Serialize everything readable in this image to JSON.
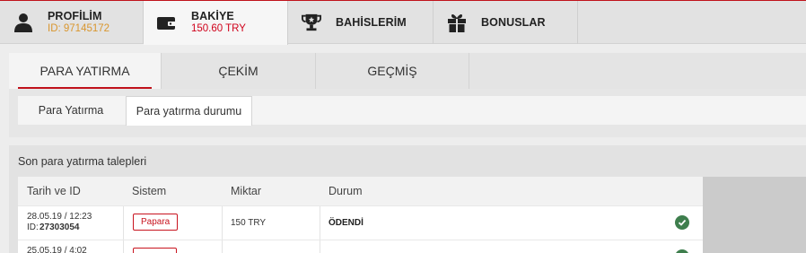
{
  "topnav": {
    "tabs": [
      {
        "title": "PROFİLİM",
        "sub": "ID: 97145172",
        "icon": "user-icon"
      },
      {
        "title": "BAKİYE",
        "sub": "150.60 TRY",
        "icon": "wallet-icon"
      },
      {
        "title": "BAHİSLERİM",
        "icon": "trophy-icon"
      },
      {
        "title": "BONUSLAR",
        "icon": "gift-icon"
      }
    ]
  },
  "subnav": {
    "tabs": [
      "PARA YATIRMA",
      "ÇEKİM",
      "GEÇMİŞ"
    ]
  },
  "subbar": {
    "items": [
      "Para Yatırma",
      "Para yatırma durumu"
    ]
  },
  "panel": {
    "caption": "Son para yatırma talepleri",
    "headers": [
      "Tarih ve ID",
      "Sistem",
      "Miktar",
      "Durum"
    ],
    "rows": [
      {
        "date": "28.05.19 / 12:23",
        "id_label": "ID:",
        "id": "27303054",
        "system": "Papara",
        "amount": "150 TRY",
        "status": "ÖDENDİ"
      },
      {
        "date": "25.05.19 / 4:02"
      }
    ]
  },
  "colors": {
    "accent": "#c0121b",
    "balance": "#d0021b",
    "id_text": "#d9962e",
    "success": "#3e7e4d"
  }
}
